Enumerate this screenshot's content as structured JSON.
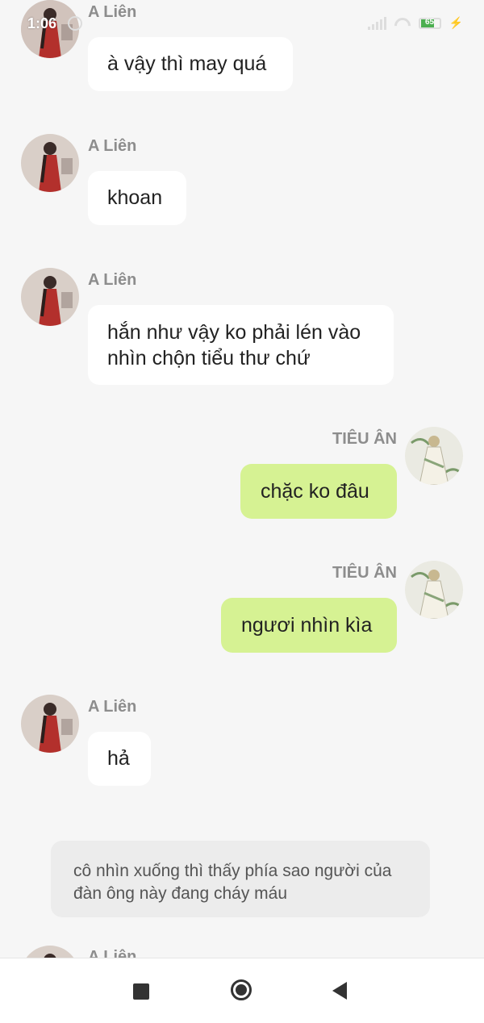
{
  "status_bar": {
    "time": "1:06",
    "battery": "65"
  },
  "messages": [
    {
      "sender": "A Liên",
      "text": "à vậy thì may quá"
    },
    {
      "sender": "A Liên",
      "text": "khoan"
    },
    {
      "sender": "A Liên",
      "text": "hắn như vậy ko phải lén vào nhìn chộn tiểu thư chứ"
    },
    {
      "sender": "TIÊU ÂN",
      "text": "chặc ko đâu"
    },
    {
      "sender": "TIÊU ÂN",
      "text": "ngươi nhìn kìa"
    },
    {
      "sender": "A Liên",
      "text": "hả"
    },
    {
      "sender": "A Liên",
      "text": ""
    }
  ],
  "narration": "cô nhìn xuống thì thấy phía sao người của đàn ông này đang cháy máu",
  "colors": {
    "incoming_bubble": "#ffffff",
    "outgoing_bubble": "#d6f293",
    "background": "#f6f6f6"
  },
  "nav_icons": [
    "recents-square-icon",
    "home-circle-icon",
    "back-triangle-icon"
  ]
}
